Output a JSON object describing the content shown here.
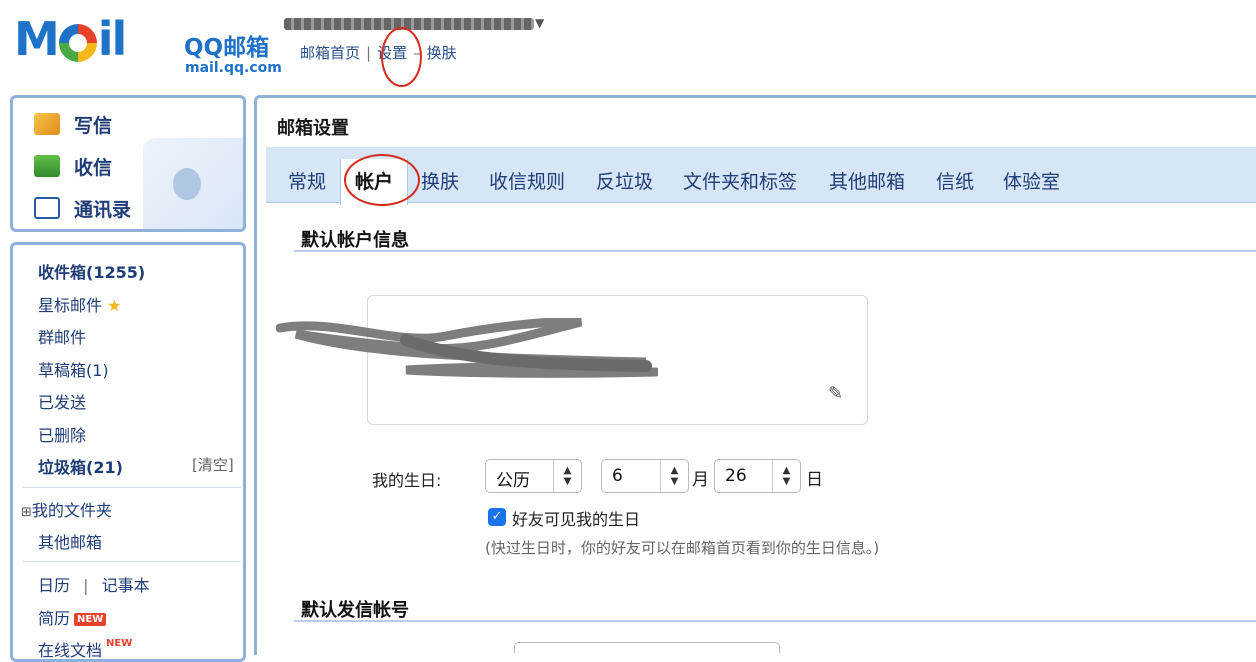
{
  "header": {
    "logo_word": "Mail",
    "brand_name": "QQ邮箱",
    "brand_domain": "mail.qq.com",
    "links": [
      "邮箱首页",
      "设置",
      "换肤"
    ],
    "separators": [
      "|",
      "–"
    ]
  },
  "sidebar": {
    "quick_actions": [
      {
        "label": "写信",
        "icon": "compose-icon"
      },
      {
        "label": "收信",
        "icon": "inbox-download-icon"
      },
      {
        "label": "通讯录",
        "icon": "contacts-card-icon"
      }
    ],
    "folders": {
      "inbox": "收件箱(1255)",
      "starred": "星标邮件",
      "group": "群邮件",
      "drafts": "草稿箱(1)",
      "sent": "已发送",
      "deleted": "已删除",
      "spam": "垃圾箱(21)",
      "spam_clear": "[清空]",
      "my_folders": "我的文件夹",
      "my_folders_toggle": "⊞",
      "other_mailbox": "其他邮箱",
      "calendar": "日历",
      "calendar_sep": "|",
      "notebook": "记事本",
      "resume": "简历",
      "online_docs": "在线文档",
      "new_badge": "NEW"
    }
  },
  "main": {
    "title": "邮箱设置",
    "tabs": [
      "常规",
      "帐户",
      "换肤",
      "收信规则",
      "反垃圾",
      "文件夹和标签",
      "其他邮箱",
      "信纸",
      "体验室"
    ],
    "active_tab": "帐户",
    "section1_title": "默认帐户信息",
    "birthday": {
      "label": "我的生日:",
      "calendar_type": "公历",
      "month": "6",
      "month_unit": "月",
      "day": "26",
      "day_unit": "日",
      "visibility_label": "好友可见我的生日",
      "visibility_checked": true,
      "hint": "(快过生日时，你的好友可以在邮箱首页看到你的生日信息。)"
    },
    "section2_title": "默认发信帐号"
  },
  "colors": {
    "brand_blue": "#1e73c8",
    "link_blue": "#1f3d77",
    "panel_border": "#8fb0d9",
    "tabbar_bg": "#d7e6f7",
    "annotation_red": "#d62a1f",
    "badge_red": "#e8412c"
  }
}
